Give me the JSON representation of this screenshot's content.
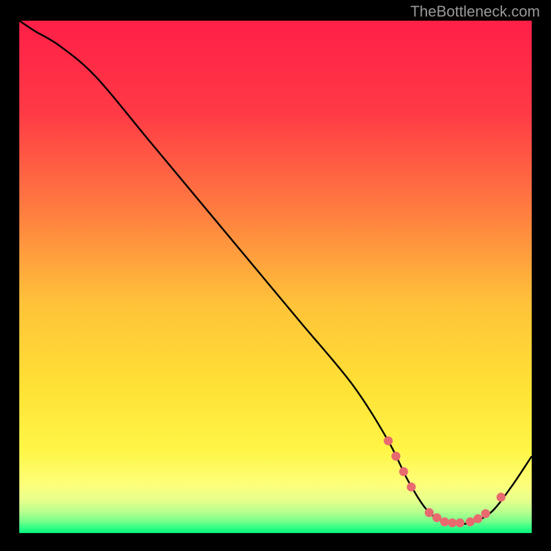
{
  "attribution": "TheBottleneck.com",
  "chart_data": {
    "type": "line",
    "title": "",
    "xlabel": "",
    "ylabel": "",
    "xlim": [
      0,
      100
    ],
    "ylim": [
      0,
      100
    ],
    "grid": false,
    "legend": false,
    "series": [
      {
        "name": "bottleneck-curve",
        "x": [
          0,
          3,
          8,
          15,
          25,
          35,
          45,
          55,
          65,
          72,
          76,
          80,
          84,
          88,
          92,
          96,
          100
        ],
        "y": [
          100,
          98,
          95,
          89,
          77,
          65,
          53,
          41,
          29,
          18,
          10,
          4,
          2,
          2,
          4,
          9,
          15
        ]
      }
    ],
    "markers": {
      "name": "highlighted-points",
      "color": "#e86a6f",
      "x": [
        72.0,
        73.5,
        75.0,
        76.5,
        80.0,
        81.5,
        83.0,
        84.5,
        86.0,
        88.0,
        89.5,
        91.0,
        94.0
      ],
      "y": [
        18.0,
        15.0,
        12.0,
        9.0,
        4.0,
        3.0,
        2.2,
        2.0,
        2.0,
        2.2,
        2.8,
        3.8,
        7.0
      ]
    },
    "background_gradient": {
      "stops": [
        {
          "offset": 0.0,
          "color": "#ff1f47"
        },
        {
          "offset": 0.18,
          "color": "#ff3a46"
        },
        {
          "offset": 0.38,
          "color": "#ff8040"
        },
        {
          "offset": 0.55,
          "color": "#ffc239"
        },
        {
          "offset": 0.72,
          "color": "#ffe236"
        },
        {
          "offset": 0.84,
          "color": "#fff647"
        },
        {
          "offset": 0.905,
          "color": "#fdff7a"
        },
        {
          "offset": 0.935,
          "color": "#e8ff8c"
        },
        {
          "offset": 0.958,
          "color": "#b9ff8e"
        },
        {
          "offset": 0.976,
          "color": "#7cff8c"
        },
        {
          "offset": 0.99,
          "color": "#2fff86"
        },
        {
          "offset": 1.0,
          "color": "#0af07b"
        }
      ]
    }
  }
}
